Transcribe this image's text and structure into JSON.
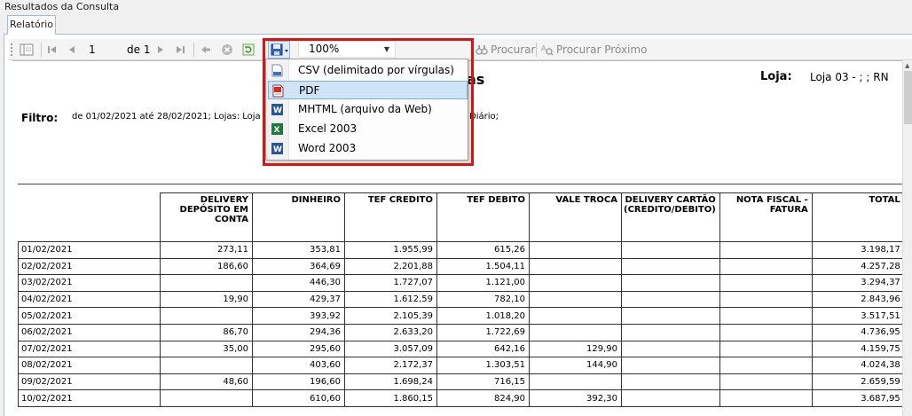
{
  "window": {
    "title": "Resultados da Consulta"
  },
  "tabs": [
    {
      "label": "Relatório"
    }
  ],
  "toolbar": {
    "page_current": "1",
    "page_of_label": "de 1",
    "zoom": "100%",
    "find_label": "Procurar",
    "find_next_label": "Procurar Próximo"
  },
  "export_menu": {
    "items": [
      {
        "label": "CSV (delimitado por vírgulas)",
        "icon": "csv-icon"
      },
      {
        "label": "PDF",
        "icon": "pdf-icon"
      },
      {
        "label": "MHTML (arquivo da Web)",
        "icon": "word-icon"
      },
      {
        "label": "Excel 2003",
        "icon": "excel-icon"
      },
      {
        "label": "Word 2003",
        "icon": "word-icon"
      }
    ],
    "selected_index": 1,
    "highlight_color": "#e01010"
  },
  "report": {
    "title_visible": "as",
    "loja_label": "Loja:",
    "loja_value": "Loja 03    -    ;  ;   RN",
    "filtro_label": "Filtro:",
    "filtro_value": "de 01/02/2021 até 28/02/2021; Lojas: Loja 0",
    "filtro_tail": "Diário;",
    "table": {
      "headers": [
        "",
        "DELIVERY DEPÓSITO EM CONTA",
        "DINHEIRO",
        "TEF CREDITO",
        "TEF DEBITO",
        "VALE TROCA",
        "DELIVERY CARTÃO (CREDITO/DEBITO)",
        "NOTA FISCAL - FATURA",
        "TOTAL"
      ],
      "rows": [
        [
          "01/02/2021",
          "273,11",
          "353,81",
          "1.955,99",
          "615,26",
          "",
          "",
          "",
          "3.198,17"
        ],
        [
          "02/02/2021",
          "186,60",
          "364,69",
          "2.201,88",
          "1.504,11",
          "",
          "",
          "",
          "4.257,28"
        ],
        [
          "03/02/2021",
          "",
          "446,30",
          "1.727,07",
          "1.121,00",
          "",
          "",
          "",
          "3.294,37"
        ],
        [
          "04/02/2021",
          "19,90",
          "429,37",
          "1.612,59",
          "782,10",
          "",
          "",
          "",
          "2.843,96"
        ],
        [
          "05/02/2021",
          "",
          "393,92",
          "2.105,39",
          "1.018,20",
          "",
          "",
          "",
          "3.517,51"
        ],
        [
          "06/02/2021",
          "86,70",
          "294,36",
          "2.633,20",
          "1.722,69",
          "",
          "",
          "",
          "4.736,95"
        ],
        [
          "07/02/2021",
          "35,00",
          "295,60",
          "3.057,09",
          "642,16",
          "129,90",
          "",
          "",
          "4.159,75"
        ],
        [
          "08/02/2021",
          "",
          "403,60",
          "2.172,37",
          "1.303,51",
          "144,90",
          "",
          "",
          "4.024,38"
        ],
        [
          "09/02/2021",
          "48,60",
          "196,60",
          "1.698,24",
          "716,15",
          "",
          "",
          "",
          "2.659,59"
        ],
        [
          "10/02/2021",
          "",
          "610,60",
          "1.860,15",
          "824,90",
          "392,30",
          "",
          "",
          "3.687,95"
        ]
      ]
    }
  }
}
